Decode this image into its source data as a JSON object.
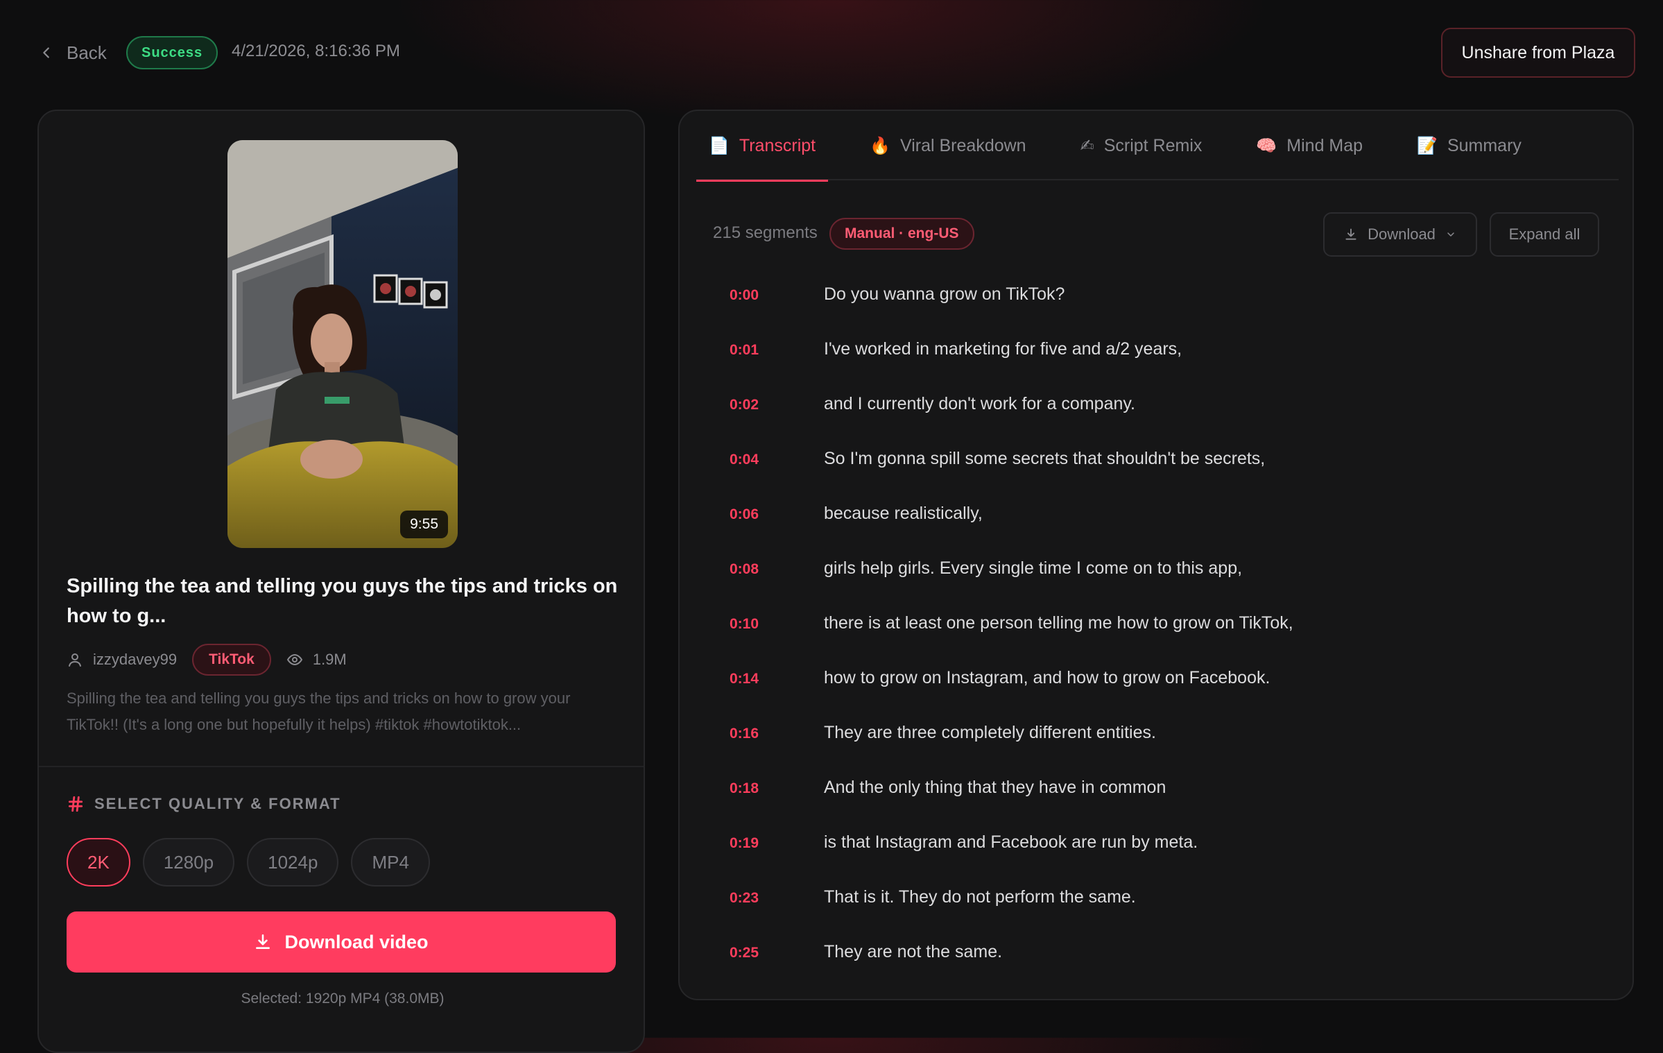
{
  "header": {
    "back_label": "Back",
    "status": "Success",
    "timestamp": "4/21/2026, 8:16:36 PM",
    "unshare_label": "Unshare from Plaza"
  },
  "video": {
    "duration": "9:55",
    "title": "Spilling the tea and telling you guys the tips and tricks on how to g...",
    "author": "izzydavey99",
    "platform": "TikTok",
    "views": "1.9M",
    "description": "Spilling the tea and telling you guys the tips and tricks on how to grow your TikTok!! (It's a long one but hopefully it helps) #tiktok #howtotiktok..."
  },
  "quality": {
    "heading": "SELECT QUALITY & FORMAT",
    "options": [
      "2K",
      "1280p",
      "1024p",
      "MP4"
    ],
    "selected": "2K",
    "download_label": "Download video",
    "selected_info": "Selected: 1920p MP4 (38.0MB)"
  },
  "tabs": [
    {
      "emoji": "📄",
      "label": "Transcript",
      "active": true
    },
    {
      "emoji": "🔥",
      "label": "Viral Breakdown",
      "active": false
    },
    {
      "emoji": "✍",
      "label": "Script Remix",
      "active": false
    },
    {
      "emoji": "🧠",
      "label": "Mind Map",
      "active": false
    },
    {
      "emoji": "📝",
      "label": "Summary",
      "active": false
    }
  ],
  "transcript": {
    "segment_count": "215 segments",
    "language_badge": "Manual · eng-US",
    "download_label": "Download",
    "expand_label": "Expand all",
    "segments": [
      {
        "time": "0:00",
        "text": "Do you wanna grow on TikTok?"
      },
      {
        "time": "0:01",
        "text": "I've worked in marketing for five and a/2 years,"
      },
      {
        "time": "0:02",
        "text": "and I currently don't work for a company."
      },
      {
        "time": "0:04",
        "text": "So I'm gonna spill some secrets that shouldn't be secrets,"
      },
      {
        "time": "0:06",
        "text": "because realistically,"
      },
      {
        "time": "0:08",
        "text": "girls help girls. Every single time I come on to this app,"
      },
      {
        "time": "0:10",
        "text": "there is at least one person telling me how to grow on TikTok,"
      },
      {
        "time": "0:14",
        "text": "how to grow on Instagram, and how to grow on Facebook."
      },
      {
        "time": "0:16",
        "text": "They are three completely different entities."
      },
      {
        "time": "0:18",
        "text": "And the only thing that they have in common"
      },
      {
        "time": "0:19",
        "text": "is that Instagram and Facebook are run by meta."
      },
      {
        "time": "0:23",
        "text": "That is it. They do not perform the same."
      },
      {
        "time": "0:25",
        "text": "They are not the same."
      }
    ]
  }
}
